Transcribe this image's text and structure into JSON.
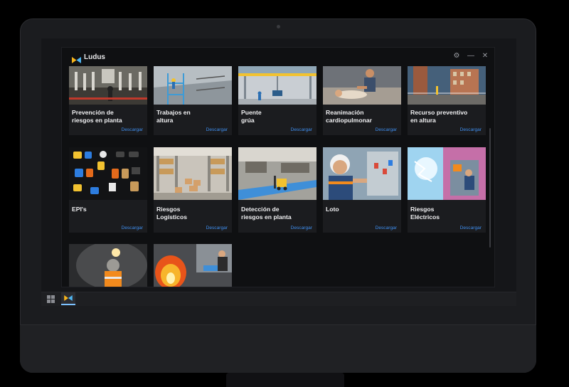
{
  "window": {
    "app_name": "Ludus"
  },
  "controls": {
    "settings": "⚙",
    "minimize": "—",
    "close": "✕"
  },
  "download_label": "Descargar",
  "cards": [
    {
      "title": "Prevención de\nriesgos en planta",
      "icon": "factory-image"
    },
    {
      "title": "Trabajos en\naltura",
      "icon": "scaffold-image"
    },
    {
      "title": "Puente\ngrúa",
      "icon": "crane-image"
    },
    {
      "title": "Reanimación\ncardiopulmonar",
      "icon": "cpr-image"
    },
    {
      "title": "Recurso preventivo\nen altura",
      "icon": "rooftop-image"
    },
    {
      "title": "EPI's",
      "icon": "ppe-image"
    },
    {
      "title": "Riesgos\nLogísticos",
      "icon": "warehouse-image"
    },
    {
      "title": "Detección de\nriesgos en planta",
      "icon": "forklift-image"
    },
    {
      "title": "Loto",
      "icon": "lockout-image"
    },
    {
      "title": "Riesgos\nEléctricos",
      "icon": "electric-image"
    },
    {
      "title": "",
      "icon": "tunnel-image"
    },
    {
      "title": "",
      "icon": "fire-image"
    }
  ],
  "colors": {
    "accent": "#3f8ff0",
    "card": "#1b1c1f",
    "window": "#0f1012"
  }
}
